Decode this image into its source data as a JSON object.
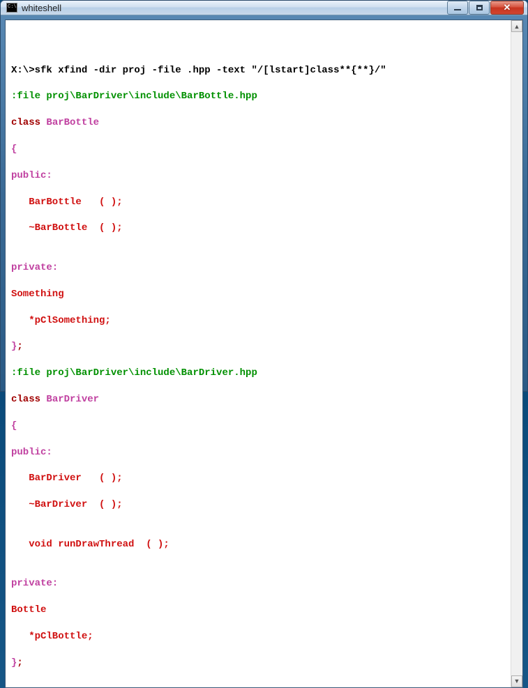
{
  "window": {
    "title": "whiteshell"
  },
  "terminal": {
    "prompt": "X:\\>",
    "command": "sfk xfind -dir proj -file .hpp -text \"/[lstart]class**{**}/\"",
    "file1_header": ":file proj\\BarDriver\\include\\BarBottle.hpp",
    "file1_l1a": "class ",
    "file1_l1b": "BarBottle",
    "file1_l2": "{",
    "file1_l3": "public:",
    "file1_l4": "   BarBottle   ( );",
    "file1_l5": "   ~BarBottle  ( );",
    "file1_l6": "",
    "file1_l7": "private:",
    "file1_l8": "Something",
    "file1_l9": "   *pClSomething;",
    "file1_l10a": "}",
    "file1_l10b": ";",
    "file2_header": ":file proj\\BarDriver\\include\\BarDriver.hpp",
    "file2_l1a": "class ",
    "file2_l1b": "BarDriver",
    "file2_l2": "{",
    "file2_l3": "public:",
    "file2_l4": "   BarDriver   ( );",
    "file2_l5": "   ~BarDriver  ( );",
    "file2_l6": "",
    "file2_l7": "   void runDrawThread  ( );",
    "file2_l8": "",
    "file2_l9": "private:",
    "file2_l10": "Bottle",
    "file2_l11": "   *pClBottle;",
    "file2_l12a": "}",
    "file2_l12b": ";"
  }
}
